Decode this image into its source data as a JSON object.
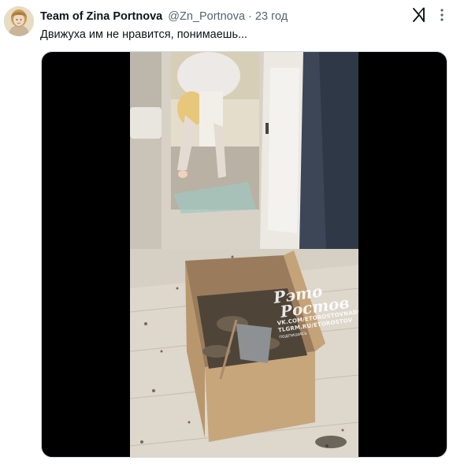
{
  "tweet": {
    "author_name": "Team of Zina Portnova",
    "handle": "@Zn_Portnova",
    "separator": "·",
    "time": "23 год",
    "text": "Движуха им не нравится, понимаешь..."
  },
  "media": {
    "watermark": {
      "line1": "Ρэто",
      "line2": "Ростов",
      "vk": "VK.COM/ETOROSTOVNADONU",
      "tg": "TLGRM.RU/ETOROSTOV",
      "subscribe": "подпишись"
    }
  },
  "icons": {
    "grok": "grok-icon",
    "more": "more-icon"
  },
  "colors": {
    "text_primary": "#0f1419",
    "text_secondary": "#536471",
    "media_background": "#000000"
  }
}
